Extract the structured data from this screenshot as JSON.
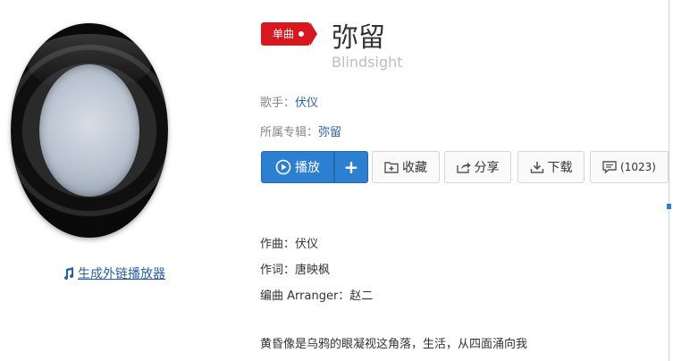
{
  "cover": {
    "ext_player_label": "生成外链播放器"
  },
  "song": {
    "badge": "单曲",
    "title": "弥留",
    "subtitle": "Blindsight",
    "singer_label": "歌手：",
    "singer": "伏仪",
    "album_label": "所属专辑：",
    "album": "弥留"
  },
  "toolbar": {
    "play_label": "播放",
    "add_label": "+",
    "collect_label": "收藏",
    "share_label": "分享",
    "download_label": "下载",
    "comment_count": "(1023)"
  },
  "credits": {
    "composer": "作曲：伏仪",
    "lyricist": "作词：唐映枫",
    "arranger": "编曲 Arranger：赵二"
  },
  "lyrics": {
    "line1": "黄昏像是乌鸦的眼凝视这角落，生活，从四面涌向我"
  },
  "colors": {
    "accent_blue": "#2d7fd2",
    "badge_red": "#d8181e",
    "link_blue": "#2a5ea8"
  },
  "icons": [
    "music-note-icon",
    "play-circle-icon",
    "plus-icon",
    "collect-icon",
    "share-icon",
    "download-icon",
    "comment-icon"
  ]
}
